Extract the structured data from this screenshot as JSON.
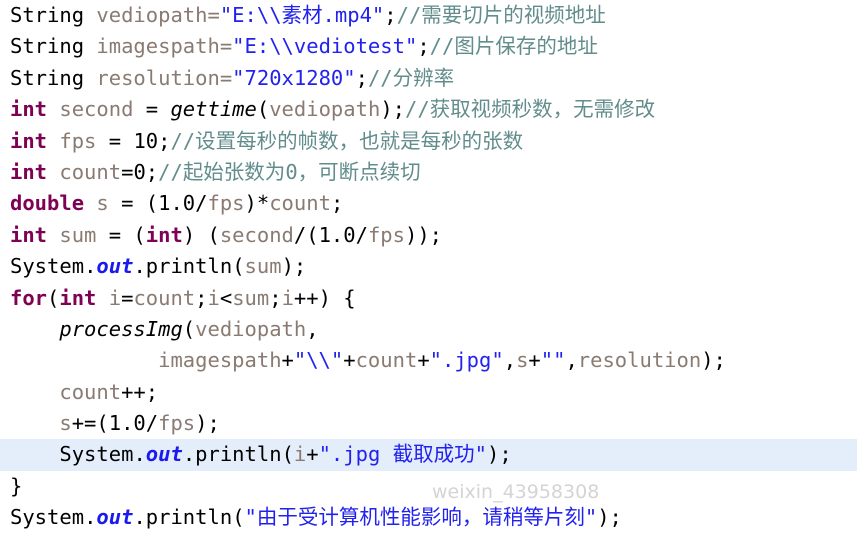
{
  "editor": {
    "language": "java",
    "background_color": "#ffffff",
    "highlight_color": "#e4eefb",
    "colors": {
      "plain": "#000000",
      "keyword": "#7e0253",
      "identifier": "#8a7b72",
      "string": "#2222ee",
      "comment": "#628d8c",
      "static_field": "#1a1aee",
      "method": "#000000"
    }
  },
  "watermark": {
    "text": "weixin_43958308"
  },
  "code": {
    "lines": [
      {
        "n": 1,
        "highlighted": false,
        "tokens": [
          {
            "t": "String",
            "c": "plain"
          },
          {
            "t": " ",
            "c": "plain"
          },
          {
            "t": "vediopath=",
            "c": "ident"
          },
          {
            "t": "\"E:\\\\素材.mp4\"",
            "c": "string"
          },
          {
            "t": ";",
            "c": "punc"
          },
          {
            "t": "//需要切片的视频地址",
            "c": "comment"
          }
        ]
      },
      {
        "n": 2,
        "highlighted": false,
        "tokens": [
          {
            "t": "String",
            "c": "plain"
          },
          {
            "t": " ",
            "c": "plain"
          },
          {
            "t": "imagespath=",
            "c": "ident"
          },
          {
            "t": "\"E:\\\\vediotest\"",
            "c": "string"
          },
          {
            "t": ";",
            "c": "punc"
          },
          {
            "t": "//图片保存的地址",
            "c": "comment"
          }
        ]
      },
      {
        "n": 3,
        "highlighted": false,
        "tokens": [
          {
            "t": "String",
            "c": "plain"
          },
          {
            "t": " ",
            "c": "plain"
          },
          {
            "t": "resolution=",
            "c": "ident"
          },
          {
            "t": "\"720x1280\"",
            "c": "string"
          },
          {
            "t": ";",
            "c": "punc"
          },
          {
            "t": "//分辨率",
            "c": "comment"
          }
        ]
      },
      {
        "n": 4,
        "highlighted": false,
        "tokens": [
          {
            "t": "int",
            "c": "keyword"
          },
          {
            "t": " ",
            "c": "plain"
          },
          {
            "t": "second",
            "c": "ident"
          },
          {
            "t": " = ",
            "c": "plain"
          },
          {
            "t": "gettime",
            "c": "method"
          },
          {
            "t": "(",
            "c": "punc"
          },
          {
            "t": "vediopath",
            "c": "ident"
          },
          {
            "t": ");",
            "c": "punc"
          },
          {
            "t": "//获取视频秒数，无需修改",
            "c": "comment"
          }
        ]
      },
      {
        "n": 5,
        "highlighted": false,
        "tokens": [
          {
            "t": "int",
            "c": "keyword"
          },
          {
            "t": " ",
            "c": "plain"
          },
          {
            "t": "fps",
            "c": "ident"
          },
          {
            "t": " = ",
            "c": "plain"
          },
          {
            "t": "10",
            "c": "num"
          },
          {
            "t": ";",
            "c": "punc"
          },
          {
            "t": "//设置每秒的帧数，也就是每秒的张数",
            "c": "comment"
          }
        ]
      },
      {
        "n": 6,
        "highlighted": false,
        "tokens": [
          {
            "t": "int",
            "c": "keyword"
          },
          {
            "t": " ",
            "c": "plain"
          },
          {
            "t": "count",
            "c": "ident"
          },
          {
            "t": "=",
            "c": "plain"
          },
          {
            "t": "0",
            "c": "num"
          },
          {
            "t": ";",
            "c": "punc"
          },
          {
            "t": "//起始张数为0，可断点续切",
            "c": "comment"
          }
        ]
      },
      {
        "n": 7,
        "highlighted": false,
        "tokens": [
          {
            "t": "double",
            "c": "keyword"
          },
          {
            "t": " ",
            "c": "plain"
          },
          {
            "t": "s",
            "c": "ident"
          },
          {
            "t": " = (",
            "c": "plain"
          },
          {
            "t": "1.0",
            "c": "num"
          },
          {
            "t": "/",
            "c": "punc"
          },
          {
            "t": "fps",
            "c": "ident"
          },
          {
            "t": ")*",
            "c": "punc"
          },
          {
            "t": "count",
            "c": "ident"
          },
          {
            "t": ";",
            "c": "punc"
          }
        ]
      },
      {
        "n": 8,
        "highlighted": false,
        "tokens": [
          {
            "t": "int",
            "c": "keyword"
          },
          {
            "t": " ",
            "c": "plain"
          },
          {
            "t": "sum",
            "c": "ident"
          },
          {
            "t": " = (",
            "c": "plain"
          },
          {
            "t": "int",
            "c": "keyword"
          },
          {
            "t": ") (",
            "c": "punc"
          },
          {
            "t": "second",
            "c": "ident"
          },
          {
            "t": "/(",
            "c": "punc"
          },
          {
            "t": "1.0",
            "c": "num"
          },
          {
            "t": "/",
            "c": "punc"
          },
          {
            "t": "fps",
            "c": "ident"
          },
          {
            "t": "));",
            "c": "punc"
          }
        ]
      },
      {
        "n": 9,
        "highlighted": false,
        "tokens": [
          {
            "t": "System",
            "c": "plain"
          },
          {
            "t": ".",
            "c": "punc"
          },
          {
            "t": "out",
            "c": "field"
          },
          {
            "t": ".",
            "c": "punc"
          },
          {
            "t": "println",
            "c": "plain"
          },
          {
            "t": "(",
            "c": "punc"
          },
          {
            "t": "sum",
            "c": "ident"
          },
          {
            "t": ");",
            "c": "punc"
          }
        ]
      },
      {
        "n": 10,
        "highlighted": false,
        "tokens": [
          {
            "t": "for",
            "c": "keyword"
          },
          {
            "t": "(",
            "c": "punc"
          },
          {
            "t": "int",
            "c": "keyword"
          },
          {
            "t": " ",
            "c": "plain"
          },
          {
            "t": "i",
            "c": "ident"
          },
          {
            "t": "=",
            "c": "punc"
          },
          {
            "t": "count",
            "c": "ident"
          },
          {
            "t": ";",
            "c": "punc"
          },
          {
            "t": "i",
            "c": "ident"
          },
          {
            "t": "<",
            "c": "punc"
          },
          {
            "t": "sum",
            "c": "ident"
          },
          {
            "t": ";",
            "c": "punc"
          },
          {
            "t": "i",
            "c": "ident"
          },
          {
            "t": "++) {",
            "c": "punc"
          }
        ]
      },
      {
        "n": 11,
        "highlighted": false,
        "tokens": [
          {
            "t": "    ",
            "c": "plain"
          },
          {
            "t": "processImg",
            "c": "method"
          },
          {
            "t": "(",
            "c": "punc"
          },
          {
            "t": "vediopath",
            "c": "ident"
          },
          {
            "t": ",",
            "c": "punc"
          }
        ]
      },
      {
        "n": 12,
        "highlighted": false,
        "tokens": [
          {
            "t": "            ",
            "c": "plain"
          },
          {
            "t": "imagespath",
            "c": "ident"
          },
          {
            "t": "+",
            "c": "punc"
          },
          {
            "t": "\"\\\\\"",
            "c": "string"
          },
          {
            "t": "+",
            "c": "punc"
          },
          {
            "t": "count",
            "c": "ident"
          },
          {
            "t": "+",
            "c": "punc"
          },
          {
            "t": "\".jpg\"",
            "c": "string"
          },
          {
            "t": ",",
            "c": "punc"
          },
          {
            "t": "s",
            "c": "ident"
          },
          {
            "t": "+",
            "c": "punc"
          },
          {
            "t": "\"\"",
            "c": "string"
          },
          {
            "t": ",",
            "c": "punc"
          },
          {
            "t": "resolution",
            "c": "ident"
          },
          {
            "t": ");",
            "c": "punc"
          }
        ]
      },
      {
        "n": 13,
        "highlighted": false,
        "tokens": [
          {
            "t": "    ",
            "c": "plain"
          },
          {
            "t": "count",
            "c": "ident"
          },
          {
            "t": "++;",
            "c": "punc"
          }
        ]
      },
      {
        "n": 14,
        "highlighted": false,
        "tokens": [
          {
            "t": "    ",
            "c": "plain"
          },
          {
            "t": "s",
            "c": "ident"
          },
          {
            "t": "+=(",
            "c": "punc"
          },
          {
            "t": "1.0",
            "c": "num"
          },
          {
            "t": "/",
            "c": "punc"
          },
          {
            "t": "fps",
            "c": "ident"
          },
          {
            "t": ");",
            "c": "punc"
          }
        ]
      },
      {
        "n": 15,
        "highlighted": true,
        "tokens": [
          {
            "t": "    ",
            "c": "plain"
          },
          {
            "t": "System",
            "c": "plain"
          },
          {
            "t": ".",
            "c": "punc"
          },
          {
            "t": "out",
            "c": "field"
          },
          {
            "t": ".",
            "c": "punc"
          },
          {
            "t": "println",
            "c": "plain"
          },
          {
            "t": "(",
            "c": "punc"
          },
          {
            "t": "i",
            "c": "ident"
          },
          {
            "t": "+",
            "c": "punc"
          },
          {
            "t": "\".jpg 截取成功\"",
            "c": "string"
          },
          {
            "t": ");",
            "c": "punc"
          }
        ]
      },
      {
        "n": 16,
        "highlighted": false,
        "tokens": [
          {
            "t": "}",
            "c": "punc"
          }
        ]
      },
      {
        "n": 17,
        "highlighted": false,
        "tokens": [
          {
            "t": "System",
            "c": "plain"
          },
          {
            "t": ".",
            "c": "punc"
          },
          {
            "t": "out",
            "c": "field"
          },
          {
            "t": ".",
            "c": "punc"
          },
          {
            "t": "println",
            "c": "plain"
          },
          {
            "t": "(",
            "c": "punc"
          },
          {
            "t": "\"由于受计算机性能影响，请稍等片刻\"",
            "c": "string"
          },
          {
            "t": ");",
            "c": "punc"
          }
        ]
      }
    ]
  }
}
